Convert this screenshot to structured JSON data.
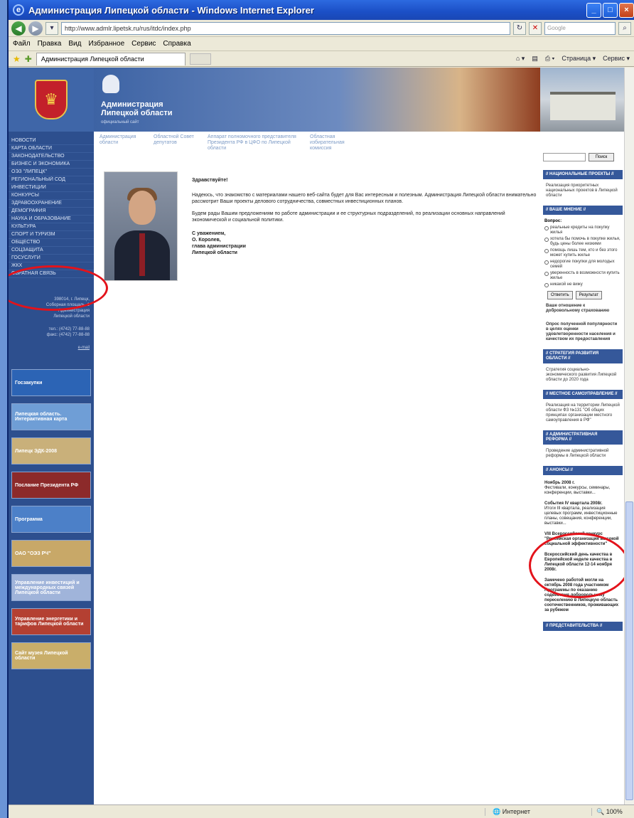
{
  "window": {
    "title": "Администрация Липецкой области - Windows Internet Explorer",
    "controls": [
      "_",
      "□",
      "×"
    ]
  },
  "address": {
    "url": "http://www.admlr.lipetsk.ru/rus/itdc/index.php",
    "search_placeholder": "Google"
  },
  "menu": [
    "Файл",
    "Правка",
    "Вид",
    "Избранное",
    "Сервис",
    "Справка"
  ],
  "tab": {
    "label": "Администрация Липецкой области"
  },
  "command_bar": [
    "Страница ▾",
    "Сервис ▾"
  ],
  "site": {
    "title_line1": "Администрация",
    "title_line2": "Липецкой области",
    "subtitle": "официальный сайт",
    "left_nav": [
      "Новости",
      "Карта области",
      "Законодательство",
      "Бизнес и экономика",
      "ОЭЗ \"Липецк\"",
      "Региональный СОД",
      "Инвестиции",
      "Конкурсы",
      "Здравоохранение",
      "Демография",
      "Наука и образование",
      "Культура",
      "Спорт и туризм",
      "Общество",
      "Соцзащита",
      "Госуслуги",
      "ЖКХ",
      "Обратная связь"
    ],
    "address_block": [
      "398014, г. Липецк,",
      "Соборная площадь, 1",
      "Администрация",
      "Липецкой области",
      "тел.: (4742) 77-88-88",
      "факс: (4742) 77-88-88",
      "e-mail"
    ],
    "left_banners": [
      "Госзакупки",
      "Липецкая область. Интерактивная карта",
      "Липецк ЭДК-2008",
      "Послание Президента РФ",
      "Программа",
      "ОАО \"ОЭЗ РЧ\"",
      "Управление инвестиций и международных связей Липецкой области",
      "Управление энергетики и тарифов Липецкой области",
      "Сайт музея Липецкой области"
    ],
    "top_nav": [
      "Администрация области",
      "Областной Совет депутатов",
      "Аппарат полномочного представителя Президента РФ в ЦФО по Липецкой области",
      "Областная избирательная комиссия"
    ],
    "greeting": "Здравствуйте!",
    "letter_p1": "Надеюсь, что знакомство с материалами нашего веб-сайта будет для Вас интересным и полезным. Администрация Липецкой области внимательно рассмотрит Ваши проекты делового сотрудничества, совместных инвестиционных планов.",
    "letter_p2": "Будем рады Вашим предложениям по работе администрации и ее структурных подразделений, по реализации основных направлений экономической и социальной политики.",
    "sign": [
      "С уважением,",
      "О. Королев,",
      "глава администрации",
      "Липецкой области"
    ]
  },
  "right": {
    "search_button": "Поиск",
    "sections": {
      "national": {
        "title": "// Национальные проекты //",
        "text": "Реализация приоритетных национальных проектов в Липецкой области"
      },
      "poll": {
        "title": "// Ваше мнение //",
        "question": "Вопрос:",
        "options": [
          "реальные кредиты на покупку жилья",
          "хотела бы помочь в покупке жилья, будь цены более низкими",
          "помощь лишь тем, кто и без этого может купить жилье",
          "недорогие покупки для молодых семей",
          "уверенность в возможности купить жилье",
          "никакой не вижу"
        ],
        "vote": "Ответить",
        "results": "Результат"
      },
      "poll_links": [
        "Ваше отношение к добровольному страхованию",
        "Опрос полученной популярности в целях оценки удовлетворенности населения и качеством их предоставления"
      ],
      "strategy": {
        "title": "// Стратегия развития области //",
        "text": "Стратегия социально-экономического развития Липецкой области до 2020 года"
      },
      "local": {
        "title": "// Местное самоуправление //",
        "text": "Реализация на территории Липецкой области ФЗ №131 \"Об общих принципах организации местного самоуправления в РФ\""
      },
      "admin_reform": {
        "title": "// Административная реформа //",
        "text": "Проведение административной реформы в Липецкой области"
      },
      "announcements": {
        "title": "// Анонсы //"
      },
      "news": [
        {
          "head": "Ноябрь 2008 г.",
          "text": "Фестивали, конкурсы, семинары, конференции, выставки..."
        },
        {
          "head": "События IV квартала 2008г.",
          "text": "Итоги III квартала, реализация целевых программ, инвестиционные планы, совещания, конференции, выставки..."
        },
        {
          "head": "VIII Всероссийский конкурс \"Российская организация высокой социальной эффективности\"",
          "text": ""
        },
        {
          "head": "Всероссийский день качества в Европейской неделе качества в Липецкой области 12-14 ноября 2008г.",
          "text": ""
        },
        {
          "head": "Замечено работой могли на октябрь 2008 года участником Программы по оказанию содействия добровольному переселению в Липецкую область соотечественников, проживающих за рубежом",
          "text": ""
        }
      ],
      "last": {
        "title": "// Представительства //"
      }
    }
  },
  "status": {
    "zone": "Интернет",
    "zoom": "100%"
  },
  "colors": {
    "site_blue": "#2d4f8e",
    "annotation_red": "#e3131b",
    "xp_title": "#1b4fc6"
  }
}
